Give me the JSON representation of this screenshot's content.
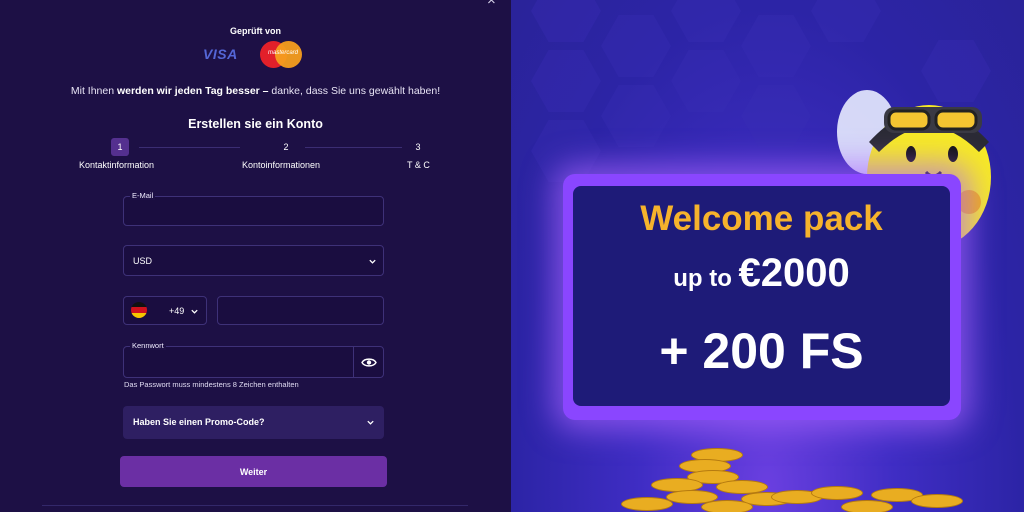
{
  "dialog": {
    "close_glyph": "×"
  },
  "payments": {
    "verified_label": "Geprüft von",
    "visa": "VISA",
    "mastercard": "mastercard"
  },
  "tagline": {
    "pre": "Mit Ihnen ",
    "bold": "werden wir jeden Tag besser –",
    "post": " danke, dass Sie uns gewählt haben!"
  },
  "form": {
    "title": "Erstellen sie ein Konto",
    "steps": [
      {
        "num": "1",
        "label": "Kontaktinformation",
        "active": true
      },
      {
        "num": "2",
        "label": "Kontoinformationen",
        "active": false
      },
      {
        "num": "3",
        "label": "T & C",
        "active": false
      }
    ],
    "email": {
      "label": "E-Mail",
      "value": ""
    },
    "currency": {
      "value": "USD",
      "icon": "chevron-down-icon"
    },
    "phone": {
      "country_code": "+49",
      "flag": "germany-flag-icon",
      "value": ""
    },
    "password": {
      "label": "Kennwort",
      "value": "",
      "icon": "eye-icon",
      "hint": "Das Passwort muss mindestens 8 Zeichen enthalten"
    },
    "promo": {
      "label": "Haben Sie einen Promo-Code?"
    },
    "submit_label": "Weiter"
  },
  "promo_banner": {
    "line1": "Welcome pack",
    "line2_small": "up to ",
    "line2_big": "€2000",
    "line3": "+ 200 FS",
    "colors": {
      "accent": "#f6b32c",
      "banner": "#1e1b78",
      "glow": "#8a46ff"
    }
  },
  "colors": {
    "panel": "#1d1045",
    "button": "#6b2fa4",
    "field_border": "#3e3178"
  }
}
